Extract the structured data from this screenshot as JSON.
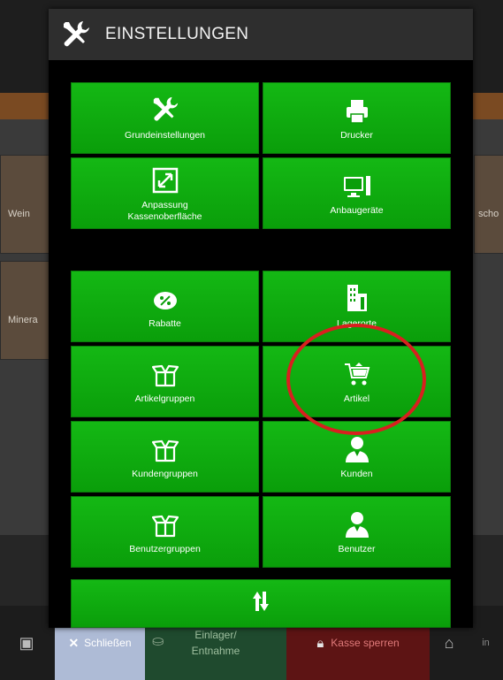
{
  "background": {
    "labels": [
      "Wein",
      "Minera",
      "scho",
      "Ein"
    ]
  },
  "dialog": {
    "title": "EINSTELLUNGEN",
    "header_icon": "tools-icon"
  },
  "tiles": [
    {
      "key": "grundeinstellungen",
      "label": "Grundeinstellungen",
      "icon": "tools-icon"
    },
    {
      "key": "drucker",
      "label": "Drucker",
      "icon": "printer-icon"
    },
    {
      "key": "anpassung",
      "label": "Anpassung\nKassenoberfläche",
      "icon": "resize-icon"
    },
    {
      "key": "anbaugeraete",
      "label": "Anbaugeräte",
      "icon": "monitor-icon"
    },
    {
      "key": "rabatte",
      "label": "Rabatte",
      "icon": "discount-icon"
    },
    {
      "key": "lagerorte",
      "label": "Lagerorte",
      "icon": "building-icon"
    },
    {
      "key": "artikelgruppen",
      "label": "Artikelgruppen",
      "icon": "box-icon"
    },
    {
      "key": "artikel",
      "label": "Artikel",
      "icon": "cart-icon"
    },
    {
      "key": "kundengruppen",
      "label": "Kundengruppen",
      "icon": "box-icon"
    },
    {
      "key": "kunden",
      "label": "Kunden",
      "icon": "user-icon"
    },
    {
      "key": "benutzergruppen",
      "label": "Benutzergruppen",
      "icon": "box-icon"
    },
    {
      "key": "benutzer",
      "label": "Benutzer",
      "icon": "user-icon"
    }
  ],
  "footer": {
    "icon": "sort-arrows-icon"
  },
  "bottom_bar": {
    "close_label": "Schließen",
    "einlager_line1": "Einlager/",
    "einlager_line2": "Entnahme",
    "lock_label": "Kasse sperren",
    "right_text": "in"
  },
  "colors": {
    "tile_green": "#0faa0f",
    "highlight_red": "#d8201f",
    "dialog_bg": "#000000",
    "header_bg": "#2e2e2e"
  }
}
